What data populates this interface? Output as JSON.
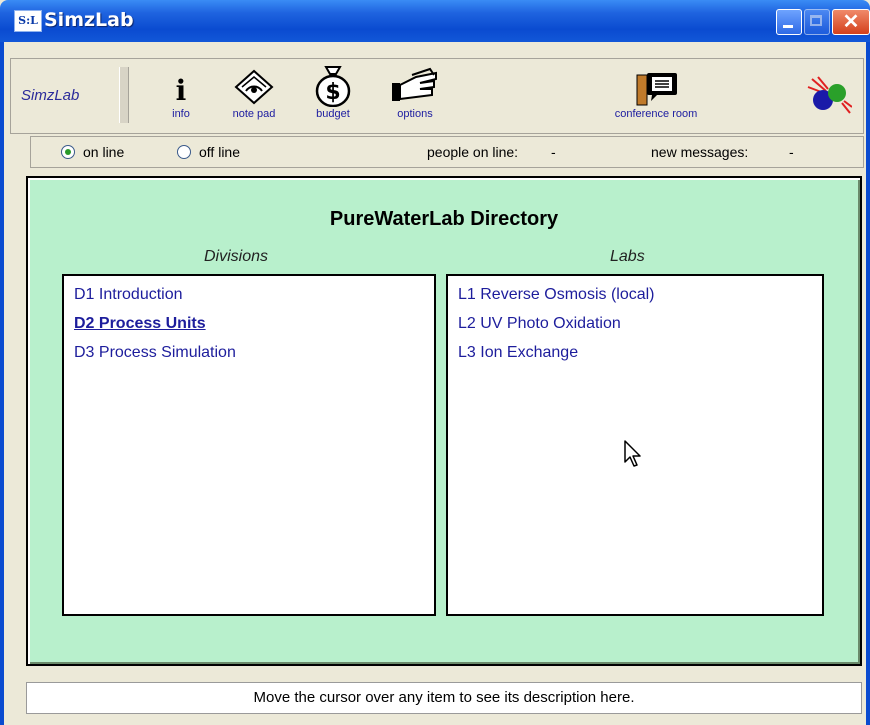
{
  "window": {
    "badge": "S:L",
    "title": "SimzLab",
    "close_glyph": "✕"
  },
  "toolbar": {
    "brand": "SimzLab",
    "info_glyph": "i",
    "info_label": "info",
    "notepad_label": "note pad",
    "budget_label": "budget",
    "options_label": "options",
    "conference_label": "conference room"
  },
  "status": {
    "online_label": "on line",
    "offline_label": "off line",
    "online_selected": true,
    "people_label": "people on line:",
    "people_value": "-",
    "messages_label": "new messages:",
    "messages_value": "-"
  },
  "directory": {
    "title": "PureWaterLab Directory",
    "divisions_header": "Divisions",
    "labs_header": "Labs",
    "divisions": [
      {
        "label": "D1 Introduction"
      },
      {
        "label": "D2 Process Units"
      },
      {
        "label": "D3 Process Simulation"
      }
    ],
    "labs": [
      {
        "label": "L1 Reverse Osmosis (local)"
      },
      {
        "label": "L2 UV Photo Oxidation"
      },
      {
        "label": "L3 Ion Exchange"
      }
    ]
  },
  "description_bar": "Move the cursor over any item to see its description here.",
  "colors": {
    "titlebar": "#0a4bd0",
    "panel_bg": "#b8f0cc",
    "link": "#1d1d9c"
  }
}
